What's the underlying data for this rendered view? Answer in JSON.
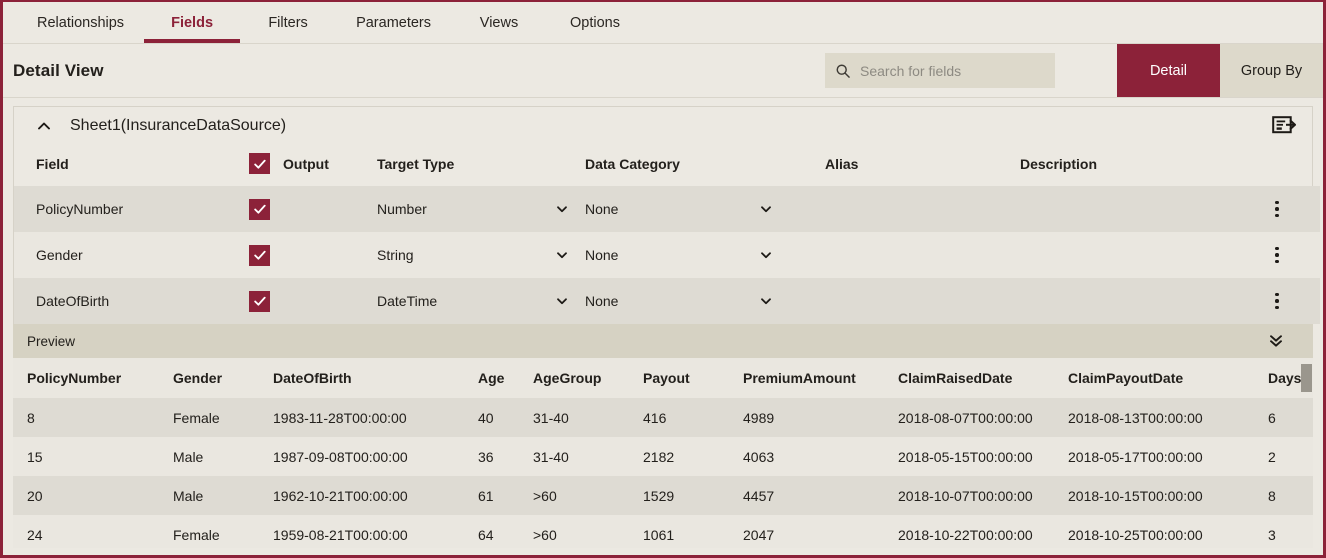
{
  "tabs": [
    {
      "label": "Relationships",
      "active": false
    },
    {
      "label": "Fields",
      "active": true
    },
    {
      "label": "Filters",
      "active": false
    },
    {
      "label": "Parameters",
      "active": false
    },
    {
      "label": "Views",
      "active": false
    },
    {
      "label": "Options",
      "active": false
    }
  ],
  "header": {
    "title": "Detail View",
    "search_placeholder": "Search for fields",
    "search_value": "",
    "search_icon": "search-icon",
    "view_modes": [
      {
        "label": "Detail",
        "active": true
      },
      {
        "label": "Group By",
        "active": false
      }
    ]
  },
  "fields_panel": {
    "collapse_icon": "chevron-up-icon",
    "source_name": "Sheet1(InsuranceDataSource)",
    "add_field_icon": "add-field-icon",
    "columns": [
      "Field",
      "Output",
      "Target Type",
      "Data Category",
      "Alias",
      "Description"
    ],
    "select_all_checked": true,
    "rows": [
      {
        "field": "PolicyNumber",
        "output_checked": true,
        "target_type": "Number",
        "data_category": "None",
        "alias": "",
        "description": ""
      },
      {
        "field": "Gender",
        "output_checked": true,
        "target_type": "String",
        "data_category": "None",
        "alias": "",
        "description": ""
      },
      {
        "field": "DateOfBirth",
        "output_checked": true,
        "target_type": "DateTime",
        "data_category": "None",
        "alias": "",
        "description": ""
      }
    ]
  },
  "preview": {
    "label": "Preview",
    "expand_icon": "double-chevron-down-icon",
    "columns": [
      "PolicyNumber",
      "Gender",
      "DateOfBirth",
      "Age",
      "AgeGroup",
      "Payout",
      "PremiumAmount",
      "ClaimRaisedDate",
      "ClaimPayoutDate",
      "Days"
    ],
    "rows": [
      [
        "8",
        "Female",
        "1983-11-28T00:00:00",
        "40",
        "31-40",
        "416",
        "4989",
        "2018-08-07T00:00:00",
        "2018-08-13T00:00:00",
        "6"
      ],
      [
        "15",
        "Male",
        "1987-09-08T00:00:00",
        "36",
        "31-40",
        "2182",
        "4063",
        "2018-05-15T00:00:00",
        "2018-05-17T00:00:00",
        "2"
      ],
      [
        "20",
        "Male",
        "1962-10-21T00:00:00",
        "61",
        ">60",
        "1529",
        "4457",
        "2018-10-07T00:00:00",
        "2018-10-15T00:00:00",
        "8"
      ],
      [
        "24",
        "Female",
        "1959-08-21T00:00:00",
        "64",
        ">60",
        "1061",
        "2047",
        "2018-10-22T00:00:00",
        "2018-10-25T00:00:00",
        "3"
      ]
    ]
  },
  "colors": {
    "accent": "#8c2239",
    "background": "#ece9e2",
    "row_odd": "#dedbd3",
    "row_even": "#eae7e0",
    "control_bg": "#ddd9cb",
    "preview_header_bg": "#d6d2c3",
    "text": "#23201c"
  }
}
